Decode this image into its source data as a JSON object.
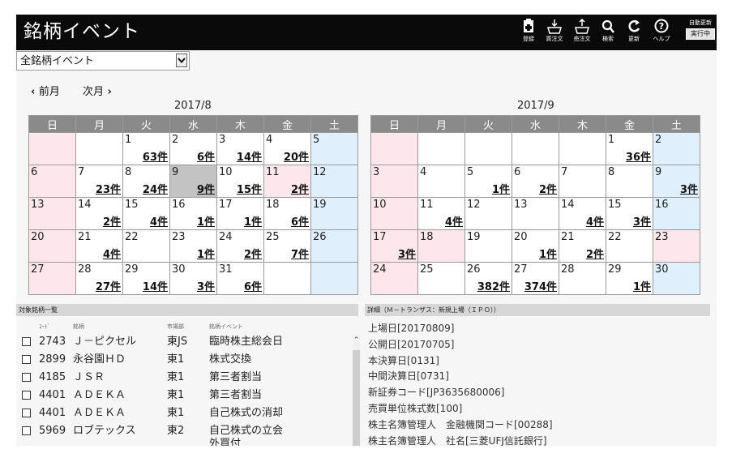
{
  "header": {
    "title": "銘柄イベント",
    "toolbar": [
      {
        "id": "register",
        "label": "登録",
        "icon": "register-icon"
      },
      {
        "id": "buy",
        "label": "買注文",
        "icon": "buy-order-icon"
      },
      {
        "id": "sell",
        "label": "売注文",
        "icon": "sell-order-icon"
      },
      {
        "id": "search",
        "label": "検索",
        "icon": "search-icon"
      },
      {
        "id": "refresh",
        "label": "更新",
        "icon": "refresh-icon"
      },
      {
        "id": "help",
        "label": "ヘルプ",
        "icon": "help-icon"
      }
    ],
    "auto_update": {
      "label": "自動更新",
      "status": "実行中"
    }
  },
  "filter": {
    "selected": "全銘柄イベント"
  },
  "nav": {
    "prev": "前月",
    "next": "次月"
  },
  "calendars": [
    {
      "month": "2017/8",
      "weekdays": [
        "日",
        "月",
        "火",
        "水",
        "木",
        "金",
        "土"
      ],
      "weeks": [
        [
          null,
          null,
          {
            "d": "1",
            "c": "63件"
          },
          {
            "d": "2",
            "c": "6件"
          },
          {
            "d": "3",
            "c": "14件"
          },
          {
            "d": "4",
            "c": "20件"
          },
          {
            "d": "5"
          }
        ],
        [
          {
            "d": "6"
          },
          {
            "d": "7",
            "c": "23件"
          },
          {
            "d": "8",
            "c": "24件"
          },
          {
            "d": "9",
            "c": "9件",
            "today": true
          },
          {
            "d": "10",
            "c": "15件"
          },
          {
            "d": "11",
            "c": "2件",
            "holiday": true
          },
          {
            "d": "12"
          }
        ],
        [
          {
            "d": "13"
          },
          {
            "d": "14",
            "c": "2件"
          },
          {
            "d": "15",
            "c": "4件"
          },
          {
            "d": "16",
            "c": "1件"
          },
          {
            "d": "17",
            "c": "1件"
          },
          {
            "d": "18",
            "c": "6件"
          },
          {
            "d": "19"
          }
        ],
        [
          {
            "d": "20"
          },
          {
            "d": "21",
            "c": "4件"
          },
          {
            "d": "22"
          },
          {
            "d": "23",
            "c": "1件"
          },
          {
            "d": "24",
            "c": "2件"
          },
          {
            "d": "25",
            "c": "7件"
          },
          {
            "d": "26"
          }
        ],
        [
          {
            "d": "27"
          },
          {
            "d": "28",
            "c": "27件"
          },
          {
            "d": "29",
            "c": "14件"
          },
          {
            "d": "30",
            "c": "3件"
          },
          {
            "d": "31",
            "c": "6件"
          },
          null,
          null
        ]
      ]
    },
    {
      "month": "2017/9",
      "weekdays": [
        "日",
        "月",
        "火",
        "水",
        "木",
        "金",
        "土"
      ],
      "weeks": [
        [
          null,
          null,
          null,
          null,
          null,
          {
            "d": "1",
            "c": "36件"
          },
          {
            "d": "2"
          }
        ],
        [
          {
            "d": "3"
          },
          {
            "d": "4"
          },
          {
            "d": "5",
            "c": "1件"
          },
          {
            "d": "6",
            "c": "2件"
          },
          {
            "d": "7"
          },
          {
            "d": "8"
          },
          {
            "d": "9",
            "c": "3件"
          }
        ],
        [
          {
            "d": "10"
          },
          {
            "d": "11",
            "c": "4件"
          },
          {
            "d": "12"
          },
          {
            "d": "13"
          },
          {
            "d": "14",
            "c": "4件"
          },
          {
            "d": "15",
            "c": "3件"
          },
          {
            "d": "16"
          }
        ],
        [
          {
            "d": "17",
            "c": "3件"
          },
          {
            "d": "18",
            "holiday": true
          },
          {
            "d": "19"
          },
          {
            "d": "20",
            "c": "1件"
          },
          {
            "d": "21",
            "c": "2件"
          },
          {
            "d": "22"
          },
          {
            "d": "23",
            "holiday": true
          }
        ],
        [
          {
            "d": "24"
          },
          {
            "d": "25"
          },
          {
            "d": "26",
            "c": "382件"
          },
          {
            "d": "27",
            "c": "374件"
          },
          {
            "d": "28"
          },
          {
            "d": "29",
            "c": "1件"
          },
          {
            "d": "30"
          }
        ]
      ]
    }
  ],
  "stock_list": {
    "title": "対象銘柄一覧",
    "columns": {
      "code": "ｺｰﾄﾞ",
      "name": "銘柄",
      "market": "市場部",
      "event": "銘柄イベント"
    },
    "rows": [
      {
        "code": "2743",
        "name": "Ｊ－ピクセル",
        "market": "東JS",
        "event": "臨時株主総会日"
      },
      {
        "code": "2899",
        "name": "永谷園ＨＤ",
        "market": "東1",
        "event": "株式交換"
      },
      {
        "code": "4185",
        "name": "ＪＳＲ",
        "market": "東1",
        "event": "第三者割当"
      },
      {
        "code": "4401",
        "name": "ＡＤＥＫＡ",
        "market": "東1",
        "event": "第三者割当"
      },
      {
        "code": "4401",
        "name": "ＡＤＥＫＡ",
        "market": "東1",
        "event": "自己株式の消却"
      },
      {
        "code": "5969",
        "name": "ロブテックス",
        "market": "東2",
        "event": "自己株式の立会外買付"
      }
    ]
  },
  "detail": {
    "title": "詳細（Ｍ－トランザス：新規上場（ＩＰＯ））",
    "lines": [
      "上場日[20170809]",
      "公開日[20170705]",
      "本決算日[0131]",
      "中間決算日[0731]",
      "新証券コード[JP3635680006]",
      "売買単位株式数[100]",
      "株主名簿管理人　金融機関コード[00288]",
      "株主名簿管理人　社名[三菱UFJ信託銀行]"
    ]
  },
  "colors": {
    "header_bg": "#0a0a0a",
    "weekday_header": "#8a8a8a",
    "sunday": "#fde6ec",
    "saturday": "#dff0fc",
    "today": "#c3c3c3"
  }
}
